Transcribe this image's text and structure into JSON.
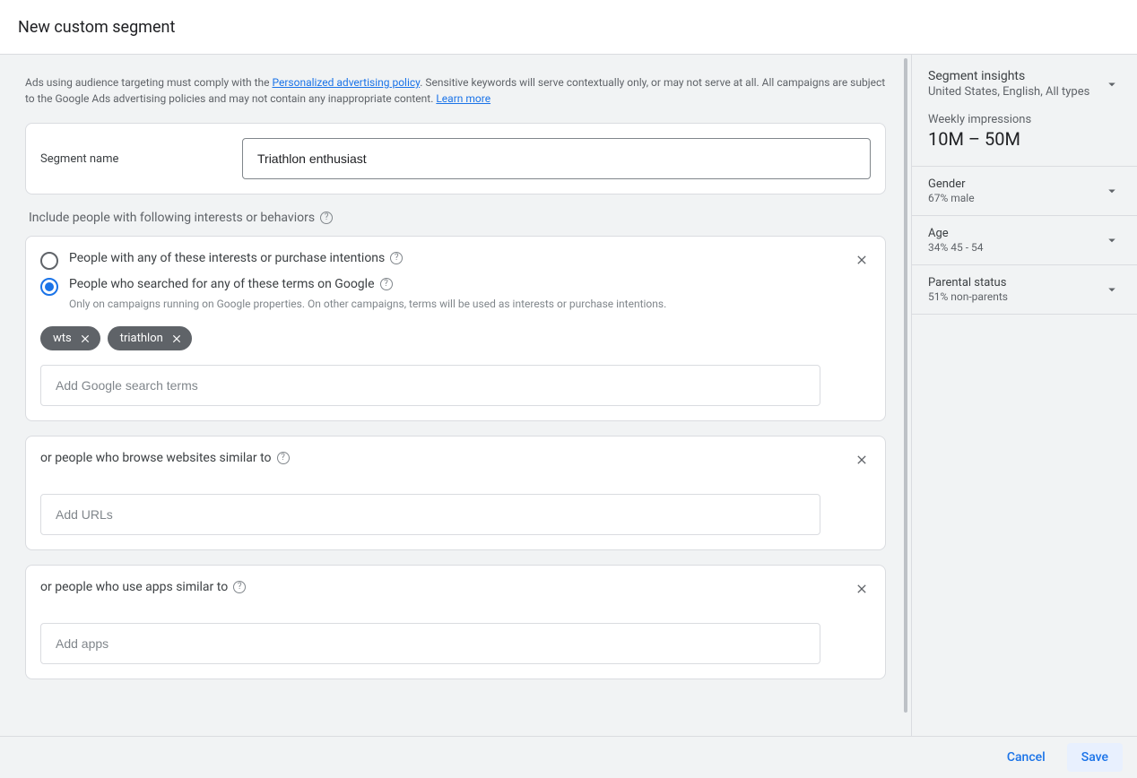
{
  "header": {
    "title": "New custom segment"
  },
  "policy": {
    "pre": "Ads using audience targeting must comply with the ",
    "link1": "Personalized advertising policy",
    "mid": ". Sensitive keywords will serve contextually only, or may not serve at all. All campaigns are subject to the Google Ads advertising policies and may not contain any inappropriate content. ",
    "link2": "Learn more"
  },
  "segment_name": {
    "label": "Segment name",
    "value": "Triathlon enthusiast"
  },
  "include_label": "Include people with following interests or behaviors",
  "interests_card": {
    "radio1": "People with any of these interests or purchase intentions",
    "radio2": "People who searched for any of these terms on Google",
    "radio2_sub": "Only on campaigns running on Google properties. On other campaigns, terms will be used as interests or purchase intentions.",
    "chips": [
      "wts",
      "triathlon"
    ],
    "input_placeholder": "Add Google search terms"
  },
  "urls_card": {
    "label": "or people who browse websites similar to",
    "input_placeholder": "Add URLs"
  },
  "apps_card": {
    "label": "or people who use apps similar to",
    "input_placeholder": "Add apps"
  },
  "insights": {
    "title": "Segment insights",
    "subtitle": "United States, English, All types",
    "impressions_label": "Weekly impressions",
    "impressions_value": "10M – 50M",
    "stats": [
      {
        "label": "Gender",
        "value": "67% male"
      },
      {
        "label": "Age",
        "value": "34% 45 - 54"
      },
      {
        "label": "Parental status",
        "value": "51% non-parents"
      }
    ]
  },
  "footer": {
    "cancel": "Cancel",
    "save": "Save"
  }
}
